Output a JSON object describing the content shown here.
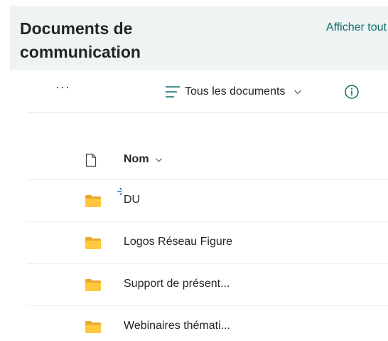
{
  "header": {
    "title": "Documents de communication",
    "show_all_label": "Afficher tout"
  },
  "toolbar": {
    "more_label": "···",
    "view_label": "Tous les documents",
    "icons": [
      "menu-lines-icon",
      "chevron-down-icon",
      "info-icon"
    ]
  },
  "list": {
    "column_name": "Nom",
    "items": [
      {
        "name": "DU",
        "type": "folder",
        "new_indicator": true
      },
      {
        "name": "Logos Réseau Figure",
        "type": "folder",
        "new_indicator": false
      },
      {
        "name": "Support de présent...",
        "type": "folder",
        "new_indicator": false
      },
      {
        "name": "Webinaires thémati...",
        "type": "folder",
        "new_indicator": false
      }
    ]
  },
  "colors": {
    "accent": "#0f6a6a",
    "header_bg": "#eef4f4",
    "folder": "#ffc83d",
    "new_indicator": "#0f6cbd"
  }
}
